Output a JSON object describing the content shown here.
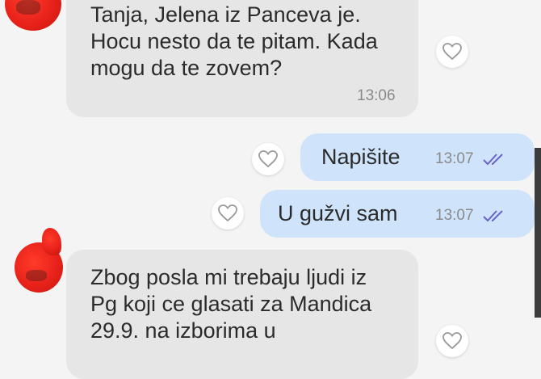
{
  "messages": [
    {
      "direction": "incoming",
      "text": "Tanja, Jelena iz Panceva je.\nHocu nesto da te pitam. Kada\nmogu da te zovem?",
      "time": "13:06",
      "icon": "heart-icon"
    },
    {
      "direction": "outgoing",
      "text": "Napišite",
      "time": "13:07",
      "status_icon": "double-check-icon",
      "icon": "heart-icon"
    },
    {
      "direction": "outgoing",
      "text": "U gužvi sam",
      "time": "13:07",
      "status_icon": "double-check-icon",
      "icon": "heart-icon"
    },
    {
      "direction": "incoming",
      "text": "Zbog posla mi trebaju ljudi iz\nPg koji ce glasati za Mandica\n29.9. na izborima u",
      "icon": "heart-icon"
    }
  ],
  "colors": {
    "incoming_bubble": "#e6e6e6",
    "outgoing_bubble": "#cfe3fb",
    "check_color": "#6a63c8",
    "avatar_red": "#e8221a"
  }
}
